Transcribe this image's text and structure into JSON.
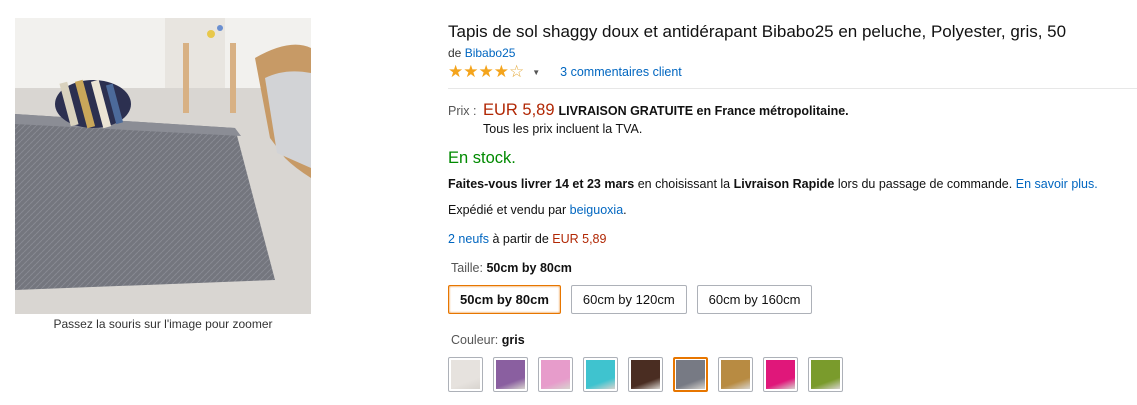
{
  "product": {
    "title": "Tapis de sol shaggy doux et antidérapant Bibabo25 en peluche, Polyester, gris, 50",
    "brand_prefix": "de",
    "brand": "Bibabo25",
    "rating_stars": 4.0,
    "reviews_link": "3 commentaires client"
  },
  "image": {
    "zoom_hint": "Passez la souris sur l'image pour zoomer"
  },
  "price": {
    "label": "Prix :",
    "amount": "EUR 5,89",
    "shipping": "LIVRAISON GRATUITE en France métropolitaine.",
    "tax_note": "Tous les prix incluent la TVA."
  },
  "stock": "En stock.",
  "delivery": {
    "bold_dates": "Faites-vous livrer 14 et 23 mars",
    "mid_text": "en choisissant la",
    "bold_option": "Livraison Rapide",
    "end_text": "lors du passage de commande.",
    "link": "En savoir plus."
  },
  "sold_by": {
    "text": "Expédié et vendu par",
    "seller": "beiguoxia",
    "period": "."
  },
  "offers": {
    "link": "2 neufs",
    "text": "à partir de",
    "price": "EUR 5,89"
  },
  "size": {
    "label": "Taille:",
    "selected": "50cm by 80cm",
    "options": [
      "50cm by 80cm",
      "60cm by 120cm",
      "60cm by 160cm"
    ]
  },
  "color": {
    "label": "Couleur:",
    "selected": "gris",
    "swatch_colors": [
      "#e6e2de",
      "#8a5fa0",
      "#e79ccb",
      "#3fc3cf",
      "#4a2d22",
      "#777a84",
      "#b88b42",
      "#e0177a",
      "#7a9b2c"
    ]
  }
}
